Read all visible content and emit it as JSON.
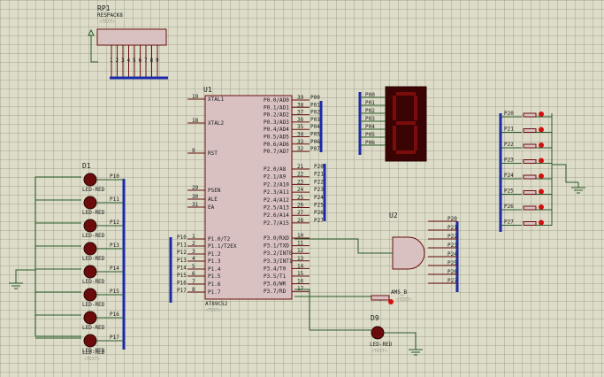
{
  "colors": {
    "grid_bg": "#dcdcc8",
    "wire": "#2a5a2a",
    "bus": "#1a2aa8",
    "chip_fill": "#d9c1c1",
    "chip_border": "#6a1010",
    "led": "#6a0c0c",
    "segment_on": "#7a0c0c",
    "segment_bg": "#3a0404",
    "probe": "#d01010"
  },
  "rp1": {
    "ref": "RP1",
    "part": "RESPACK8",
    "text": "<TEXT>",
    "pins": [
      "1",
      "2",
      "3",
      "4",
      "5",
      "6",
      "7",
      "8",
      "9"
    ]
  },
  "u1": {
    "ref": "U1",
    "part": "AT89C52",
    "text": "<TEXT>",
    "left_pins": [
      {
        "num": "19",
        "name": "XTAL1"
      },
      {
        "num": "18",
        "name": "XTAL2"
      },
      {
        "num": "9",
        "name": "RST"
      },
      {
        "num": "29",
        "name": "PSEN"
      },
      {
        "num": "30",
        "name": "ALE"
      },
      {
        "num": "31",
        "name": "EA"
      },
      {
        "num": "1",
        "name": "P1.0/T2"
      },
      {
        "num": "2",
        "name": "P1.1/T2EX"
      },
      {
        "num": "3",
        "name": "P1.2"
      },
      {
        "num": "4",
        "name": "P1.3"
      },
      {
        "num": "5",
        "name": "P1.4"
      },
      {
        "num": "6",
        "name": "P1.5"
      },
      {
        "num": "7",
        "name": "P1.6"
      },
      {
        "num": "8",
        "name": "P1.7"
      }
    ],
    "right_pins": [
      {
        "num": "39",
        "name": "P0.0/AD0"
      },
      {
        "num": "38",
        "name": "P0.1/AD1"
      },
      {
        "num": "37",
        "name": "P0.2/AD2"
      },
      {
        "num": "36",
        "name": "P0.3/AD3"
      },
      {
        "num": "35",
        "name": "P0.4/AD4"
      },
      {
        "num": "34",
        "name": "P0.5/AD5"
      },
      {
        "num": "33",
        "name": "P0.6/AD6"
      },
      {
        "num": "32",
        "name": "P0.7/AD7"
      },
      {
        "num": "21",
        "name": "P2.0/A8"
      },
      {
        "num": "22",
        "name": "P2.1/A9"
      },
      {
        "num": "23",
        "name": "P2.2/A10"
      },
      {
        "num": "24",
        "name": "P2.3/A11"
      },
      {
        "num": "25",
        "name": "P2.4/A12"
      },
      {
        "num": "26",
        "name": "P2.5/A13"
      },
      {
        "num": "27",
        "name": "P2.6/A14"
      },
      {
        "num": "28",
        "name": "P2.7/A15"
      },
      {
        "num": "10",
        "name": "P3.0/RXD"
      },
      {
        "num": "11",
        "name": "P3.1/TXD"
      },
      {
        "num": "12",
        "name": "P3.2/INT0"
      },
      {
        "num": "13",
        "name": "P3.3/INT1"
      },
      {
        "num": "14",
        "name": "P3.4/T0"
      },
      {
        "num": "15",
        "name": "P3.5/T1"
      },
      {
        "num": "16",
        "name": "P3.6/WR"
      },
      {
        "num": "17",
        "name": "P3.7/RD"
      }
    ]
  },
  "p0_net": [
    "P00",
    "P01",
    "P02",
    "P03",
    "P04",
    "P05",
    "P06",
    "P07"
  ],
  "p2_net": [
    "P20",
    "P21",
    "P22",
    "P23",
    "P24",
    "P25",
    "P26",
    "P27"
  ],
  "p1_net": [
    "P10",
    "P11",
    "P12",
    "P13",
    "P14",
    "P15",
    "P16",
    "P17"
  ],
  "display": {
    "pins": [
      "P00",
      "P01",
      "P02",
      "P03",
      "P04",
      "P05",
      "P06"
    ]
  },
  "switches": {
    "labels": [
      "P20",
      "P21",
      "P22",
      "P23",
      "P24",
      "P25",
      "P26",
      "P27"
    ]
  },
  "u2": {
    "ref": "U2",
    "inputs": [
      "P20",
      "P21",
      "P22",
      "P23",
      "P24",
      "P25",
      "P26",
      "P27"
    ]
  },
  "led_bar": {
    "ref": "D1",
    "part": "LED-RED",
    "text": "<TEXT>",
    "count": 8
  },
  "button": {
    "part": "AMS_B",
    "text": "<TEXT>"
  },
  "d9": {
    "ref": "D9",
    "part": "LED-RED",
    "text": "<TEXT>"
  }
}
